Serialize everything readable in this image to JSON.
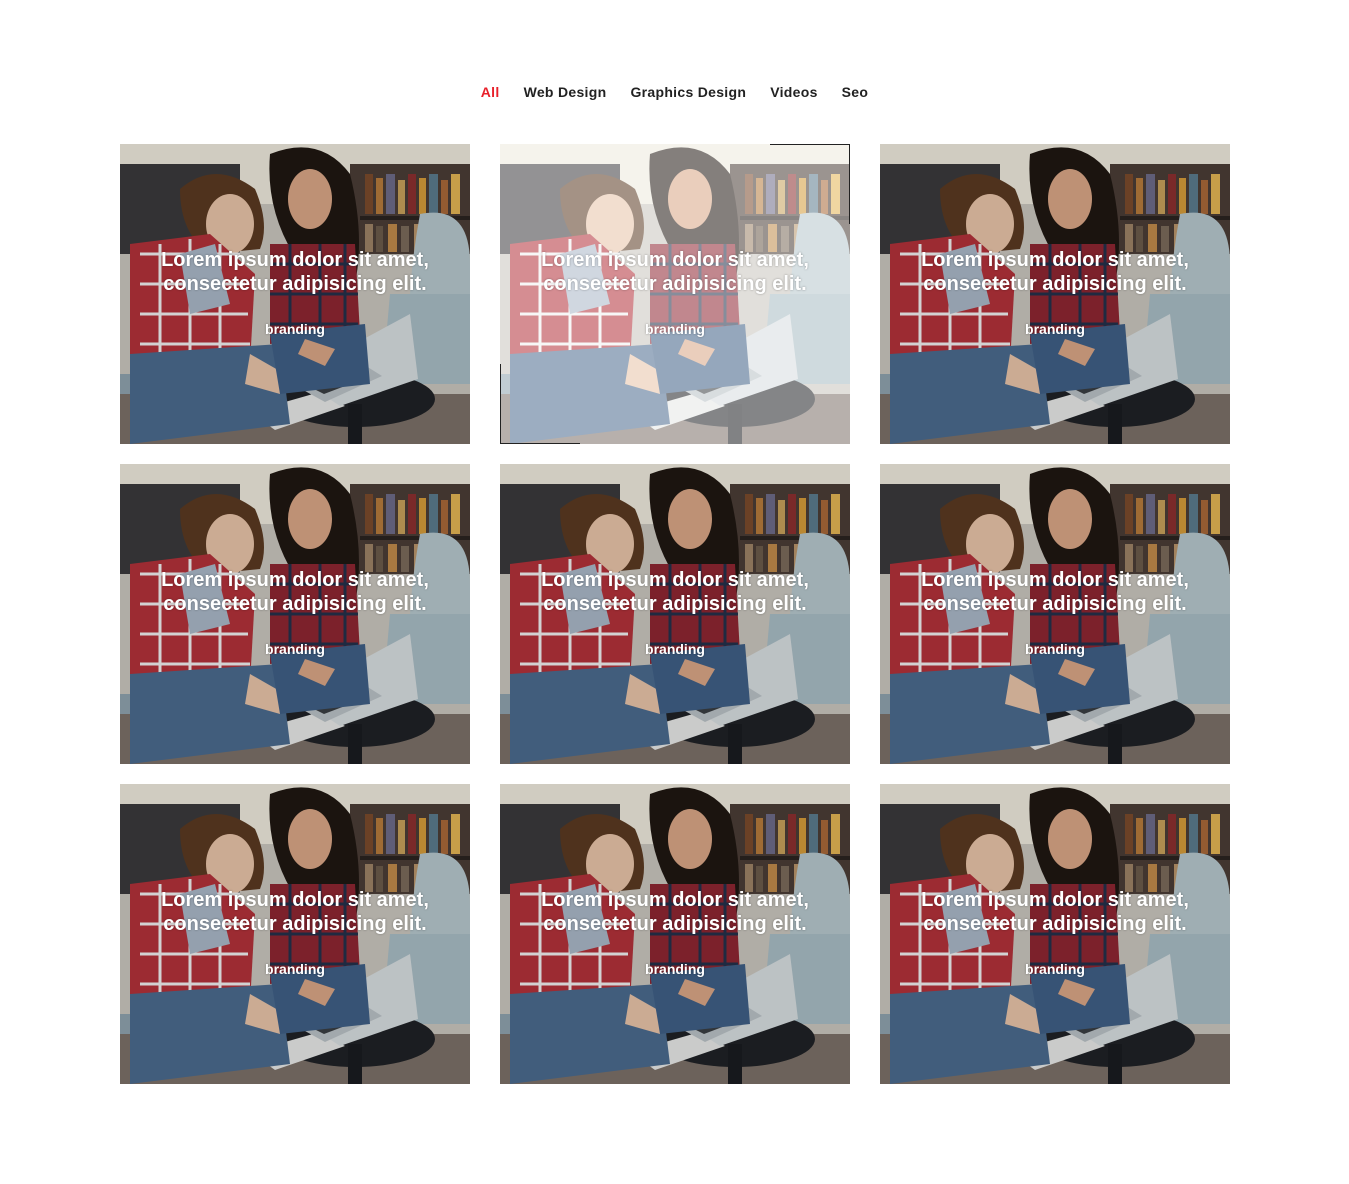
{
  "filters": {
    "items": [
      {
        "label": "All",
        "active": true
      },
      {
        "label": "Web Design",
        "active": false
      },
      {
        "label": "Graphics Design",
        "active": false
      },
      {
        "label": "Videos",
        "active": false
      },
      {
        "label": "Seo",
        "active": false
      }
    ],
    "active_color": "#e8202a",
    "text_color": "#222222"
  },
  "portfolio": {
    "items": [
      {
        "caption_line1": "Lorem ipsum dolor sit amet,",
        "caption_line2": "consectetur adipisicing elit.",
        "tag": "branding",
        "image": "two-women-laptop-photo",
        "hovered": false
      },
      {
        "caption_line1": "Lorem ipsum dolor sit amet,",
        "caption_line2": "consectetur adipisicing elit.",
        "tag": "branding",
        "image": "two-women-laptop-photo",
        "hovered": true
      },
      {
        "caption_line1": "Lorem ipsum dolor sit amet,",
        "caption_line2": "consectetur adipisicing elit.",
        "tag": "branding",
        "image": "two-women-laptop-photo",
        "hovered": false
      },
      {
        "caption_line1": "Lorem ipsum dolor sit amet,",
        "caption_line2": "consectetur adipisicing elit.",
        "tag": "branding",
        "image": "two-women-laptop-photo",
        "hovered": false
      },
      {
        "caption_line1": "Lorem ipsum dolor sit amet,",
        "caption_line2": "consectetur adipisicing elit.",
        "tag": "branding",
        "image": "two-women-laptop-photo",
        "hovered": false
      },
      {
        "caption_line1": "Lorem ipsum dolor sit amet,",
        "caption_line2": "consectetur adipisicing elit.",
        "tag": "branding",
        "image": "two-women-laptop-photo",
        "hovered": false
      },
      {
        "caption_line1": "Lorem ipsum dolor sit amet,",
        "caption_line2": "consectetur adipisicing elit.",
        "tag": "branding",
        "image": "two-women-laptop-photo",
        "hovered": false
      },
      {
        "caption_line1": "Lorem ipsum dolor sit amet,",
        "caption_line2": "consectetur adipisicing elit.",
        "tag": "branding",
        "image": "two-women-laptop-photo",
        "hovered": false
      },
      {
        "caption_line1": "Lorem ipsum dolor sit amet,",
        "caption_line2": "consectetur adipisicing elit.",
        "tag": "branding",
        "image": "two-women-laptop-photo",
        "hovered": false
      }
    ]
  }
}
